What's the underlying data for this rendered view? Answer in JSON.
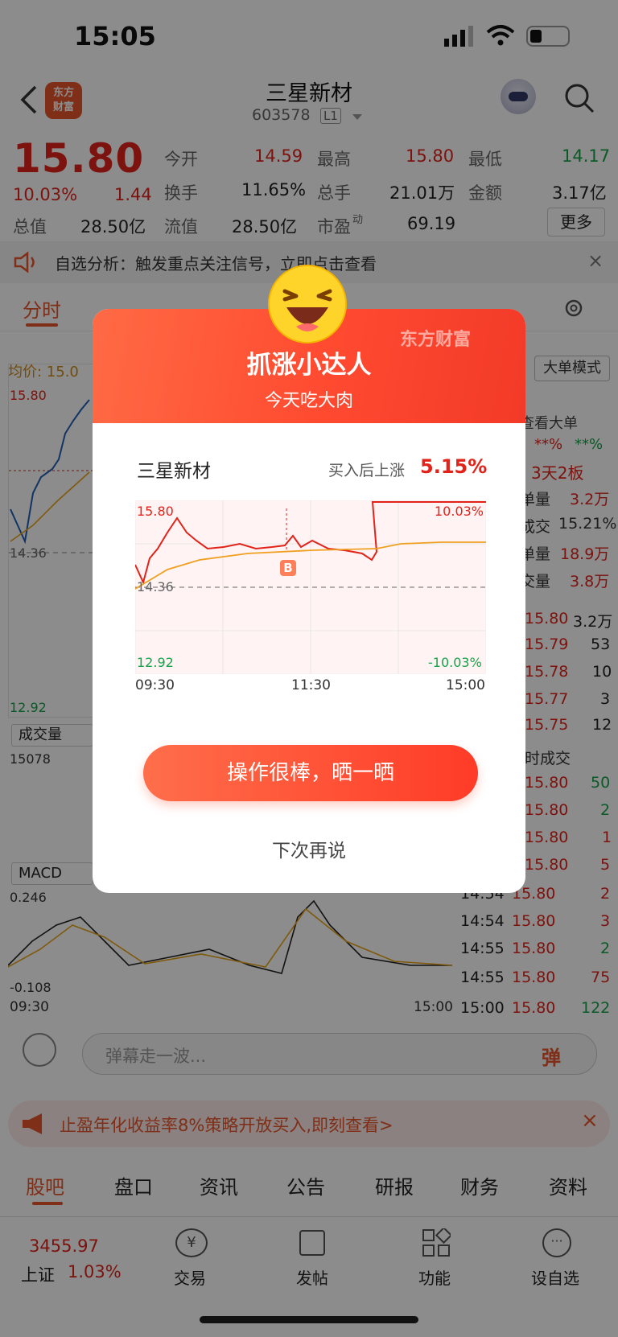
{
  "status": {
    "time": "15:05"
  },
  "header": {
    "title": "三星新材",
    "code": "603578",
    "level": "L1",
    "logo_line1": "东方",
    "logo_line2": "财富"
  },
  "quote": {
    "price": "15.80",
    "change_pct": "10.03%",
    "change": "1.44",
    "fields": [
      {
        "label": "今开",
        "value": "14.59",
        "color": "red"
      },
      {
        "label": "最高",
        "value": "15.80",
        "color": "red"
      },
      {
        "label": "最低",
        "value": "14.17",
        "color": "green"
      },
      {
        "label": "换手",
        "value": "11.65%",
        "color": "dark"
      },
      {
        "label": "总手",
        "value": "21.01万",
        "color": "dark"
      },
      {
        "label": "金额",
        "value": "3.17亿",
        "color": "dark"
      },
      {
        "label": "总值",
        "value": "28.50亿",
        "color": "dark"
      },
      {
        "label": "流值",
        "value": "28.50亿",
        "color": "dark"
      },
      {
        "label": "市盈",
        "value": "69.19",
        "color": "dark"
      }
    ],
    "pe_sup": "动",
    "more_label": "更多"
  },
  "notice": {
    "text": "自选分析：触发重点关注信号，立即点击查看"
  },
  "chart_tabs": {
    "active": "分时",
    "avg_label": "均价: 15.0",
    "mode_label": "大单模式"
  },
  "left_chart": {
    "top_price": "15.80",
    "mid_price": "14.36",
    "bottom_price": "12.92",
    "volume_label": "成交量",
    "volume_max": "15078",
    "macd_label": "MACD",
    "macd_top": "0.246",
    "macd_bottom": "-0.108",
    "t_start": "09:30",
    "t_end": "15:00"
  },
  "right_panel": {
    "view_big": "查看大单",
    "pct1": "**%",
    "pct2": "**%",
    "board": "3天2板",
    "rows": [
      {
        "label": "单量",
        "value": "3.2万"
      },
      {
        "label": "成交",
        "value": "15.21%"
      },
      {
        "label": "单量",
        "value": "18.9万"
      },
      {
        "label": "交量",
        "value": "3.8万"
      }
    ],
    "book": [
      {
        "price": "15.80",
        "vol": "3.2万"
      },
      {
        "price": "15.79",
        "vol": "53"
      },
      {
        "price": "15.78",
        "vol": "10"
      },
      {
        "price": "15.77",
        "vol": "3"
      },
      {
        "price": "15.75",
        "vol": "12"
      }
    ],
    "ticks_title": "时成交",
    "ticks": [
      {
        "time": "",
        "price": "15.80",
        "vol": "50"
      },
      {
        "time": "",
        "price": "15.80",
        "vol": "2"
      },
      {
        "time": "",
        "price": "15.80",
        "vol": "1"
      },
      {
        "time": "",
        "price": "15.80",
        "vol": "5"
      },
      {
        "time": "14:54",
        "price": "15.80",
        "vol": "2"
      },
      {
        "time": "14:54",
        "price": "15.80",
        "vol": "3"
      },
      {
        "time": "14:55",
        "price": "15.80",
        "vol": "2"
      },
      {
        "time": "14:55",
        "price": "15.80",
        "vol": "75"
      },
      {
        "time": "15:00",
        "price": "15.80",
        "vol": "122"
      }
    ]
  },
  "modal": {
    "title": "抓涨小达人",
    "subtitle": "今天吃大肉",
    "brand": "东方财富",
    "stock_name": "三星新材",
    "rise_label": "买入后上涨",
    "rise_value": "5.15%",
    "chart": {
      "top_price": "15.80",
      "mid_price": "14.36",
      "bottom_price": "12.92",
      "top_pct": "10.03%",
      "bottom_pct": "-10.03%",
      "t_start": "09:30",
      "t_mid": "11:30",
      "t_end": "15:00",
      "buy_marker": "B"
    },
    "share_button": "操作很棒，晒一晒",
    "later_button": "下次再说"
  },
  "comment": {
    "placeholder": "弹幕走一波...",
    "send_label": "弹"
  },
  "ad": {
    "text": "止盈年化收益率8%策略开放买入,即刻查看>"
  },
  "bottom_tabs": [
    "股吧",
    "盘口",
    "资讯",
    "公告",
    "研报",
    "财务",
    "资料"
  ],
  "dock": {
    "index_value": "3455.97",
    "index_name": "上证",
    "index_pct": "1.03%",
    "items": [
      "交易",
      "发帖",
      "功能",
      "设自选"
    ]
  },
  "chart_data": {
    "type": "line",
    "title": "",
    "x": [
      "09:30",
      "11:30",
      "15:00"
    ],
    "series": [],
    "ylim": [
      12.92,
      15.8
    ]
  }
}
